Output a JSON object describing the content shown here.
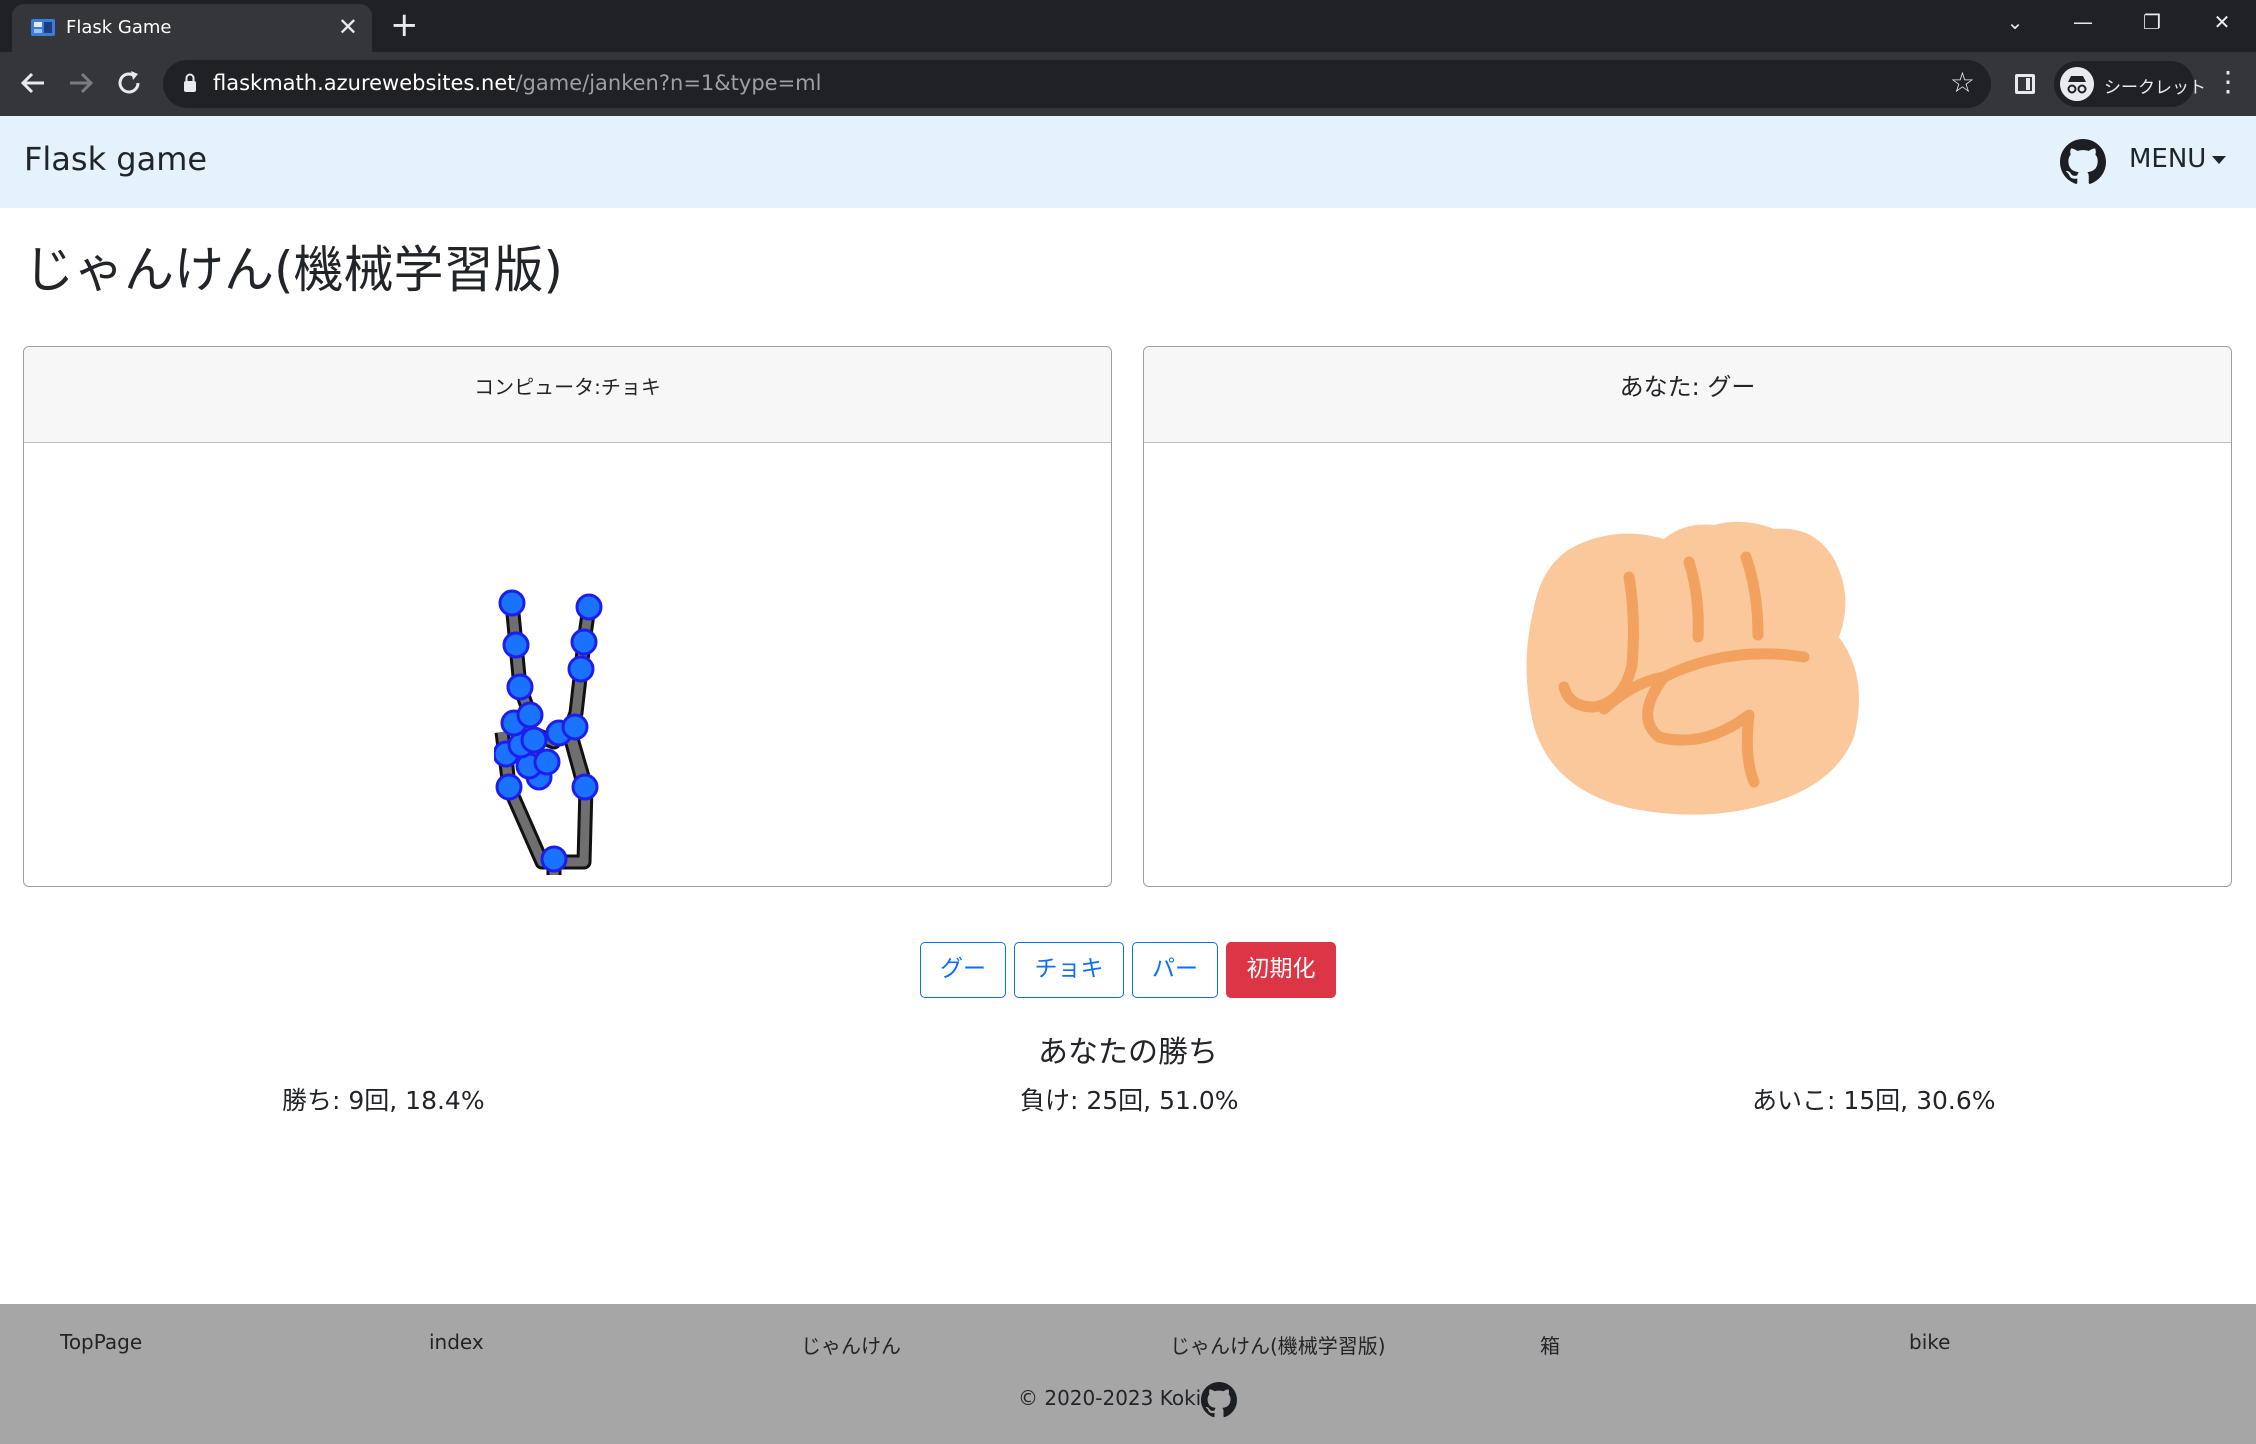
{
  "browser": {
    "tab_title": "Flask Game",
    "tab_close": "✕",
    "new_tab": "+",
    "url_host": "flaskmath.azurewebsites.net",
    "url_path": "/game/janken?n=1&type=ml",
    "incognito_label": "シークレット",
    "window_controls": [
      "⌄",
      "—",
      "❐",
      "✕"
    ]
  },
  "navbar": {
    "brand": "Flask game",
    "menu_label": "MENU"
  },
  "page": {
    "title": "じゃんけん(機械学習版)"
  },
  "cards": {
    "computer_label": "コンピュータ:チョキ",
    "player_label": "あなた: グー"
  },
  "buttons": {
    "rock": "グー",
    "scissors": "チョキ",
    "paper": "パー",
    "reset": "初期化"
  },
  "result": {
    "message": "あなたの勝ち",
    "wins": "勝ち: 9回, 18.4%",
    "losses": "負け: 25回, 51.0%",
    "draws": "あいこ: 15回, 30.6%"
  },
  "footer": {
    "links": [
      "TopPage",
      "index",
      "じゃんけん",
      "じゃんけん(機械学習版)",
      "箱",
      "bike"
    ],
    "copyright": "© 2020-2023 Koki"
  },
  "colors": {
    "navbar_bg": "#e3f2fd",
    "primary": "#0d6efd",
    "danger": "#dc3545",
    "landmark": "#1a73ff",
    "skin": "#fbc89c",
    "skin_line": "#f2a15e",
    "footer_bg": "#a6a6a6"
  }
}
